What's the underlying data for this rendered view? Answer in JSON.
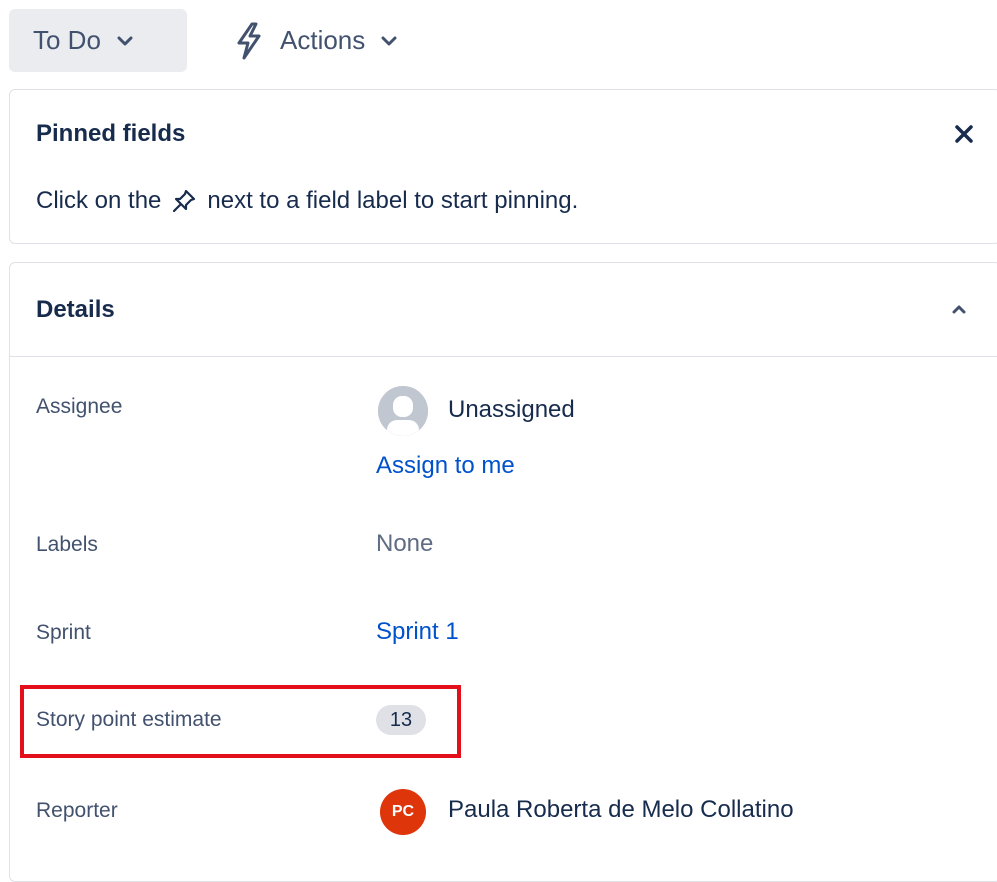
{
  "toolbar": {
    "status_label": "To Do",
    "actions_label": "Actions"
  },
  "pinned": {
    "title": "Pinned fields",
    "hint_before": "Click on the",
    "hint_after": "next to a field label to start pinning."
  },
  "details": {
    "title": "Details",
    "fields": {
      "assignee": {
        "label": "Assignee",
        "value": "Unassigned",
        "action": "Assign to me"
      },
      "labels": {
        "label": "Labels",
        "value": "None"
      },
      "sprint": {
        "label": "Sprint",
        "value": "Sprint 1"
      },
      "story_points": {
        "label": "Story point estimate",
        "value": "13"
      },
      "reporter": {
        "label": "Reporter",
        "initials": "PC",
        "value": "Paula Roberta de Melo Collatino"
      }
    }
  },
  "colors": {
    "link": "#0052cc",
    "highlight": "#e3101c",
    "reporter_avatar": "#de350b"
  },
  "icons": [
    "chevron-down-icon",
    "lightning-icon",
    "close-icon",
    "pin-icon",
    "chevron-up-icon",
    "user-avatar-icon"
  ]
}
